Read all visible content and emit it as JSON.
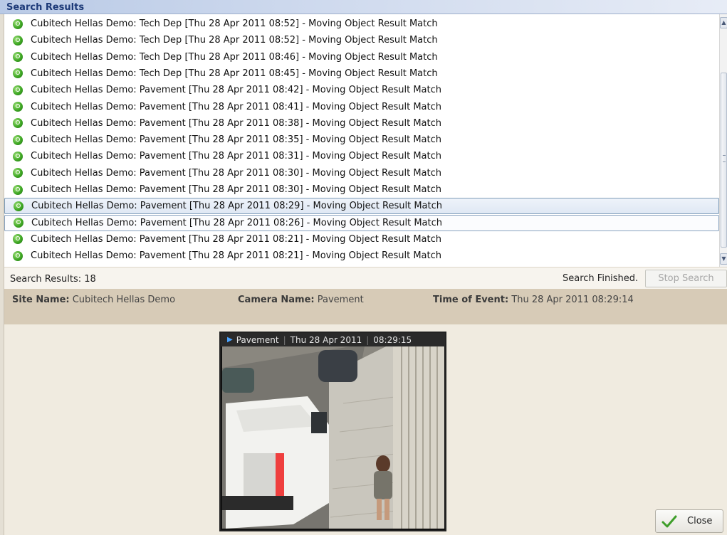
{
  "panel": {
    "title": "Search Results"
  },
  "results": [
    "Cubitech Hellas Demo: Tech Dep [Thu 28 Apr 2011  08:52] - Moving Object Result Match",
    "Cubitech Hellas Demo: Tech Dep [Thu 28 Apr 2011  08:52] - Moving Object Result Match",
    "Cubitech Hellas Demo: Tech Dep [Thu 28 Apr 2011  08:46] - Moving Object Result Match",
    "Cubitech Hellas Demo: Tech Dep [Thu 28 Apr 2011  08:45] - Moving Object Result Match",
    "Cubitech Hellas Demo: Pavement [Thu 28 Apr 2011  08:42] - Moving Object Result Match",
    "Cubitech Hellas Demo: Pavement [Thu 28 Apr 2011  08:41] - Moving Object Result Match",
    "Cubitech Hellas Demo: Pavement [Thu 28 Apr 2011  08:38] - Moving Object Result Match",
    "Cubitech Hellas Demo: Pavement [Thu 28 Apr 2011  08:35] - Moving Object Result Match",
    "Cubitech Hellas Demo: Pavement [Thu 28 Apr 2011  08:31] - Moving Object Result Match",
    "Cubitech Hellas Demo: Pavement [Thu 28 Apr 2011  08:30] - Moving Object Result Match",
    "Cubitech Hellas Demo: Pavement [Thu 28 Apr 2011  08:30] - Moving Object Result Match",
    "Cubitech Hellas Demo: Pavement [Thu 28 Apr 2011  08:29] - Moving Object Result Match",
    "Cubitech Hellas Demo: Pavement [Thu 28 Apr 2011  08:26] - Moving Object Result Match",
    "Cubitech Hellas Demo: Pavement [Thu 28 Apr 2011  08:21] - Moving Object Result Match",
    "Cubitech Hellas Demo: Pavement [Thu 28 Apr 2011  08:21] - Moving Object Result Match"
  ],
  "selected_index": 11,
  "status": {
    "count": "Search Results: 18",
    "finished": "Search Finished.",
    "stop_button": "Stop Search"
  },
  "details": {
    "site_label": "Site Name:",
    "site_value": "Cubitech Hellas Demo",
    "camera_label": "Camera Name:",
    "camera_value": "Pavement",
    "time_label": "Time of Event:",
    "time_value": "Thu 28 Apr 2011  08:29:14"
  },
  "viewer": {
    "camera": "Pavement",
    "date": "Thu 28 Apr 2011",
    "time": "08:29:15"
  },
  "close_button": "Close",
  "icons": {
    "result": "search-match-icon",
    "close": "checkmark-icon",
    "play": "play-icon"
  },
  "colors": {
    "title_text": "#1d3a78",
    "info_bar": "#d7cbb7",
    "background": "#f0ebe0"
  }
}
